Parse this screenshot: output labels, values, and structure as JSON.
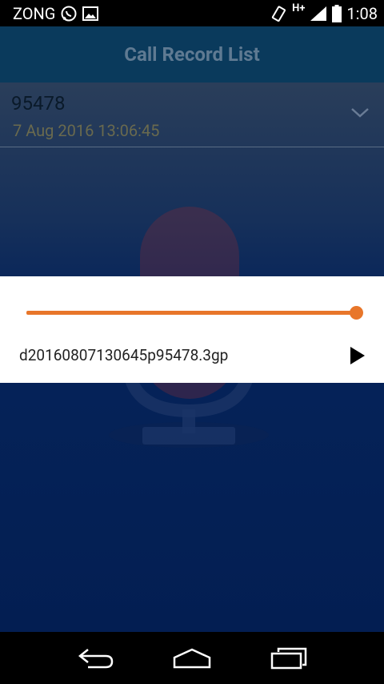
{
  "status_bar": {
    "carrier": "ZONG",
    "network_type": "H+",
    "time": "1:08",
    "icons": [
      "whatsapp-icon",
      "image-icon",
      "vibrate-icon",
      "signal-icon",
      "battery-icon"
    ]
  },
  "app_bar": {
    "title": "Call Record List"
  },
  "records": [
    {
      "number": "95478",
      "date": "7 Aug 2016 13:06:45"
    }
  ],
  "player": {
    "file_name": "d20160807130645p95478.3gp",
    "progress": 1.0,
    "accent_color": "#e8762a"
  },
  "nav_bar": {
    "icons": [
      "back-icon",
      "home-icon",
      "recents-icon"
    ]
  },
  "colors": {
    "app_bar": "#0a3a5c",
    "background": "#031e52",
    "accent": "#e8762a"
  }
}
